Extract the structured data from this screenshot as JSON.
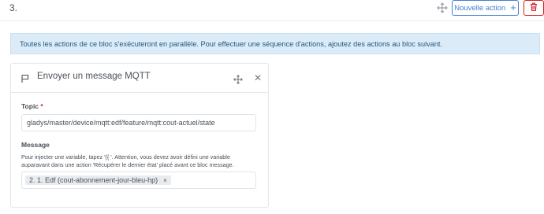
{
  "header": {
    "step_number": "3.",
    "new_action_label": "Nouvelle action",
    "new_action_icon": "plus-icon",
    "delete_icon": "trash-icon"
  },
  "alert": {
    "text": "Toutes les actions de ce bloc s'exécuteront en parallèle. Pour effectuer une séquence d'actions, ajoutez des actions au bloc suivant."
  },
  "card": {
    "title": "Envoyer un message MQTT",
    "topic_label": "Topic",
    "topic_required": "*",
    "topic_value": "gladys/master/device/mqtt:edf/feature/mqtt:cout-actuel/state",
    "message_label": "Message",
    "message_help": "Pour injecter une variable, tapez '{{ '. Attention, vous devez avoir défini une variable auparavant dans une action 'Récupérer le dernier état' placé avant ce bloc message.",
    "message_tag": "2. 1. Edf (cout-abonnement-jour-bleu-hp)",
    "message_tag_remove": "×"
  },
  "colors": {
    "primary": "#467fcf",
    "danger": "#cd201f",
    "info_bg": "#dbecf8",
    "info_text": "#24587e"
  }
}
